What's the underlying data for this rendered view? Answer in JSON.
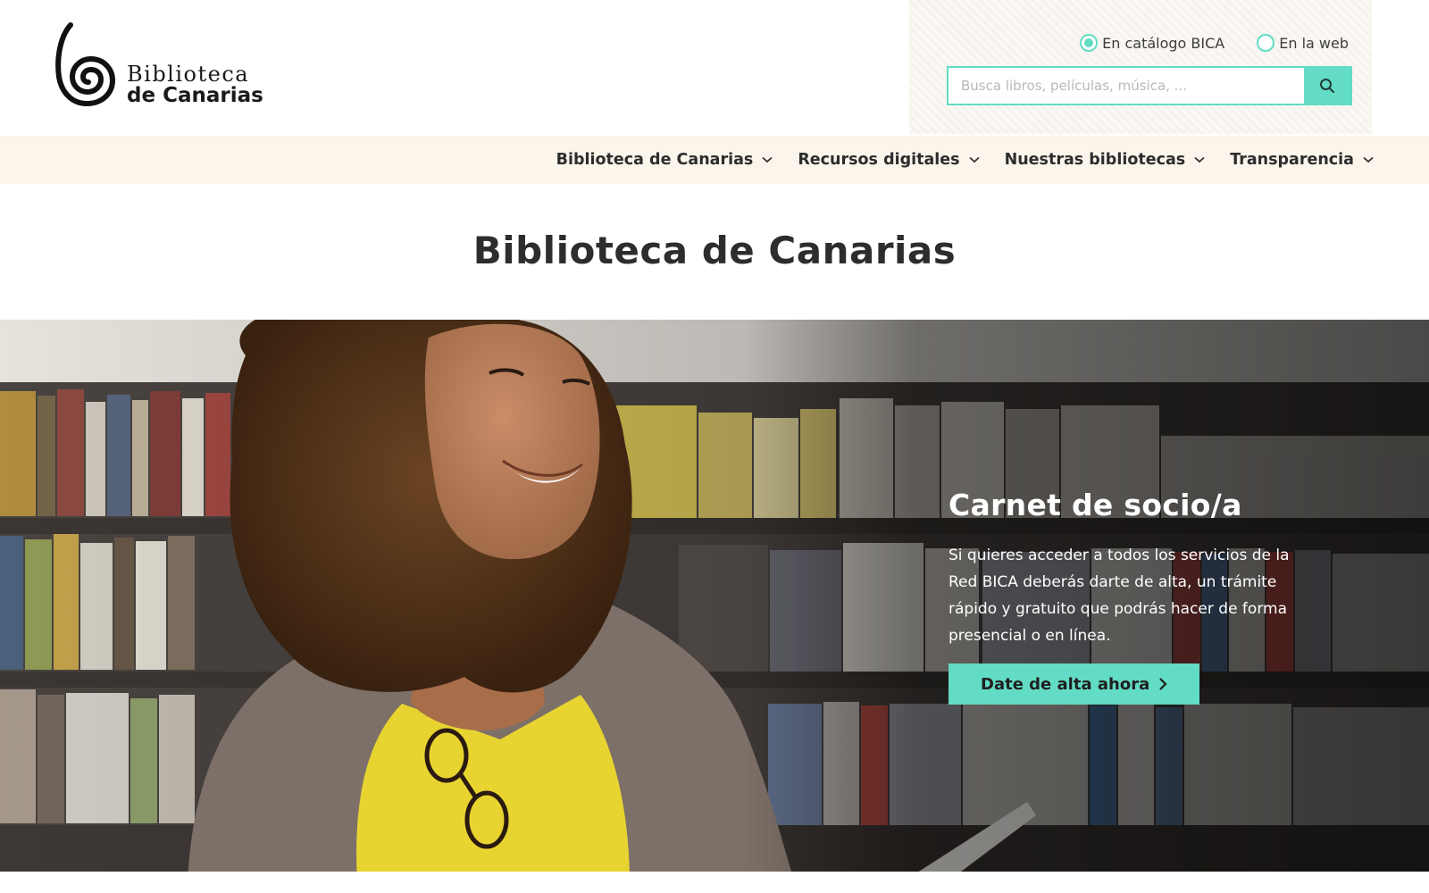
{
  "logo": {
    "line1": "Biblioteca",
    "line2": "de Canarias"
  },
  "search": {
    "options": [
      {
        "label": "En catálogo BICA",
        "checked": true
      },
      {
        "label": "En la web",
        "checked": false
      }
    ],
    "placeholder": "Busca libros, películas, música, ...",
    "button_icon": "search-icon"
  },
  "nav": {
    "items": [
      {
        "label": "Biblioteca de Canarias"
      },
      {
        "label": "Recursos digitales"
      },
      {
        "label": "Nuestras bibliotecas"
      },
      {
        "label": "Transparencia"
      }
    ]
  },
  "page": {
    "title": "Biblioteca de Canarias"
  },
  "hero": {
    "title": "Carnet de socio/a",
    "text": "Si quieres acceder a todos los servicios de la Red BICA deberás darte de alta, un trámite rápido y gratuito que podrás hacer de forma presencial o en línea.",
    "button_label": "Date de alta ahora",
    "button_icon": "chevron-right-icon"
  },
  "colors": {
    "accent": "#62dcc4",
    "nav_background": "#fbf5ec",
    "text": "#2d2d2d"
  }
}
